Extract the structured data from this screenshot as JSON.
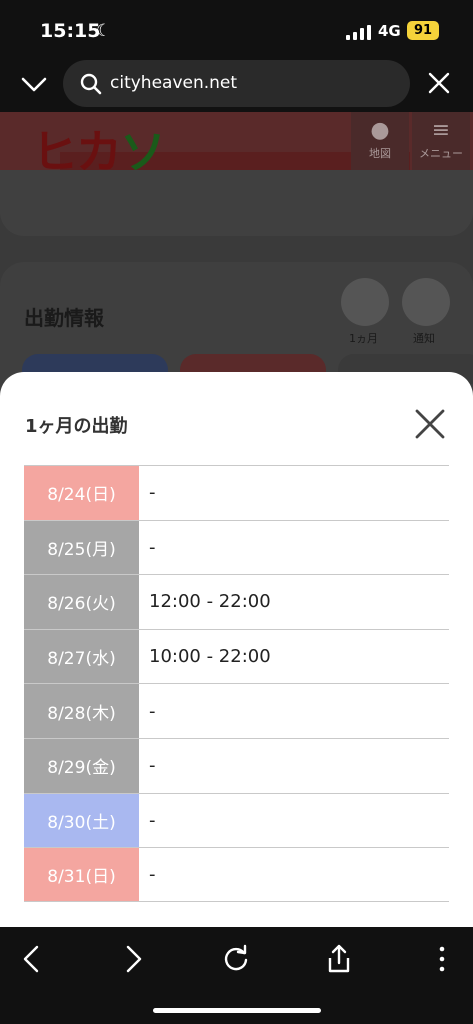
{
  "status_bar": {
    "time": "15:15",
    "network": "4G",
    "battery": "91"
  },
  "browser": {
    "url": "cityheaven.net"
  },
  "page": {
    "logo_text": "ヒカ",
    "logo_accent": "ソ",
    "map_label": "地図",
    "menu_label": "メニュー",
    "section_title": "出勤情報",
    "month_label": "1ヵ月",
    "notify_label": "通知"
  },
  "modal": {
    "title": "1ヶ月の出勤",
    "schedule": [
      {
        "date": "8/24(日)",
        "time": "-",
        "color": "#f4a6a0"
      },
      {
        "date": "8/25(月)",
        "time": "-",
        "color": "#a6a6a6"
      },
      {
        "date": "8/26(火)",
        "time": "12:00 - 22:00",
        "color": "#a6a6a6"
      },
      {
        "date": "8/27(水)",
        "time": "10:00 - 22:00",
        "color": "#a6a6a6"
      },
      {
        "date": "8/28(木)",
        "time": "-",
        "color": "#a6a6a6"
      },
      {
        "date": "8/29(金)",
        "time": "-",
        "color": "#a6a6a6"
      },
      {
        "date": "8/30(土)",
        "time": "-",
        "color": "#a9b8f0"
      },
      {
        "date": "8/31(日)",
        "time": "-",
        "color": "#f4a6a0"
      }
    ]
  }
}
